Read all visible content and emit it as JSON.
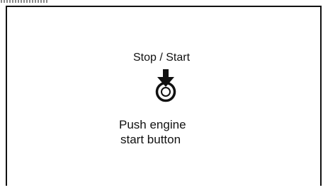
{
  "display": {
    "title": "Stop / Start",
    "message_line1": "Push engine",
    "message_line2": "start button",
    "icon": "push-button-arrow-icon",
    "colors": {
      "background": "#ffffff",
      "foreground": "#111111"
    }
  }
}
